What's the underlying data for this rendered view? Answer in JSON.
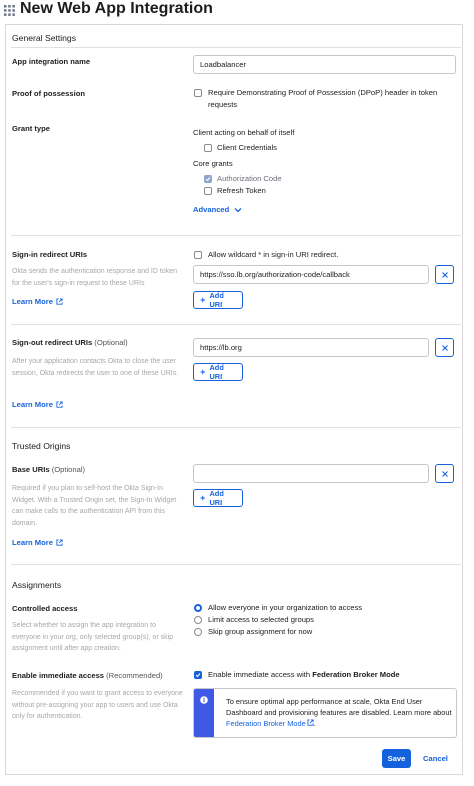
{
  "page": {
    "title": "New Web App Integration"
  },
  "general": {
    "section_title": "General Settings",
    "app_name_label": "App integration name",
    "app_name_value": "Loadbalancer",
    "pop_label": "Proof of possession",
    "pop_checkbox_line1": "Require Demonstrating Proof of Possession (DPoP) header in token",
    "pop_checkbox_line2": "requests",
    "grant_type_label": "Grant type",
    "client_acting_heading": "Client acting on behalf of itself",
    "client_credentials": "Client Credentials",
    "core_grants_heading": "Core grants",
    "authorization_code": "Authorization Code",
    "refresh_token": "Refresh Token",
    "advanced_label": "Advanced"
  },
  "signin": {
    "label": "Sign-in redirect URIs",
    "hint": "Okta sends the authentication response and ID token for the user's sign-in request to these URIs",
    "learn_more": "Learn More",
    "wildcard_label": "Allow wildcard * in sign-in URI redirect.",
    "uri_value": "https://sso.lb.org/authorization-code/callback",
    "add_uri": "Add URI"
  },
  "signout": {
    "label": "Sign-out redirect URIs",
    "optional": "(Optional)",
    "hint": "After your application contacts Okta to close the user session, Okta redirects the user to one of these URIs.",
    "learn_more": "Learn More",
    "uri_value": "https://lb.org",
    "add_uri": "Add URI"
  },
  "trusted": {
    "section_title": "Trusted Origins",
    "base_uris_label": "Base URIs",
    "optional": "(Optional)",
    "hint": "Required if you plan to self-host the Okta Sign-In Widget. With a Trusted Origin set, the Sign-In Widget can make calls to the authentication API from this domain.",
    "learn_more": "Learn More",
    "uri_value": "",
    "add_uri": "Add URI"
  },
  "assignments": {
    "section_title": "Assignments",
    "controlled_label": "Controlled access",
    "controlled_hint": "Select whether to assign the app integration to everyone in your org, only selected group(s), or skip assignment until after app creation.",
    "radio_everyone": "Allow everyone in your organization to access",
    "radio_limit": "Limit access to selected groups",
    "radio_skip": "Skip group assignment for now",
    "immediate_label": "Enable immediate access",
    "recommended": "(Recommended)",
    "immediate_hint": "Recommended if you want to grant access to everyone without pre-assigning your app to users and use Okta only for authentication.",
    "immediate_checkbox_prefix": "Enable immediate access with",
    "immediate_checkbox_bold": "Federation Broker Mode",
    "callout_text": "To ensure optimal app performance at scale, Okta End User Dashboard and provisioning features are disabled. Learn more about",
    "callout_link": "Federation Broker Mode"
  },
  "footer": {
    "save": "Save",
    "cancel": "Cancel"
  },
  "colors": {
    "accent": "#1662dd",
    "callout_bar": "#3f59e4",
    "border": "#d7d7dc"
  }
}
